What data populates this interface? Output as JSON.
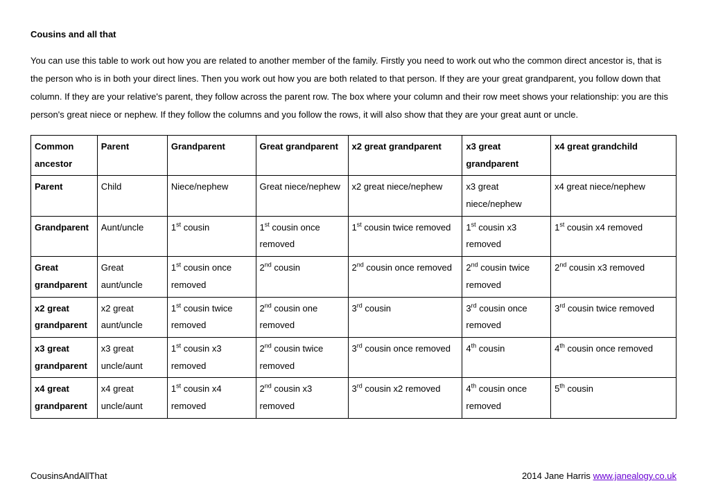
{
  "title": "Cousins and all that",
  "intro": "You can use this table to work out how you are related to another member of the family. Firstly you need to work out who the common direct ancestor is, that is the person who is in both your direct lines. Then you work out how you are both related to that person. If they are your great grandparent, you follow down that column. If they are your relative's parent, they follow across the parent row. The box where your column and their row meet shows your relationship: you are this person's great niece or nephew. If they follow the columns and you follow the rows, it will also show that they are your great aunt or uncle.",
  "headers": {
    "c0": "Common ancestor",
    "c1": "Parent",
    "c2": "Grandparent",
    "c3": "Great grandparent",
    "c4": "x2 great grandparent",
    "c5": "x3 great grandparent",
    "c6": "x4 great grandchild"
  },
  "rows": [
    {
      "h": "Parent",
      "c1": {
        "t": "Child"
      },
      "c2": {
        "t": "Niece/nephew"
      },
      "c3": {
        "t": "Great niece/nephew"
      },
      "c4": {
        "t": "x2 great niece/nephew"
      },
      "c5": {
        "t": "x3 great niece/nephew"
      },
      "c6": {
        "t": "x4 great niece/nephew"
      }
    },
    {
      "h": "Grandparent",
      "c1": {
        "t": "Aunt/uncle"
      },
      "c2": {
        "o": "1",
        "s": "st",
        "r": " cousin"
      },
      "c3": {
        "o": "1",
        "s": "st",
        "r": " cousin once removed"
      },
      "c4": {
        "o": "1",
        "s": "st",
        "r": " cousin twice removed"
      },
      "c5": {
        "o": "1",
        "s": "st",
        "r": " cousin x3 removed"
      },
      "c6": {
        "o": "1",
        "s": "st",
        "r": " cousin x4 removed"
      }
    },
    {
      "h": "Great grandparent",
      "c1": {
        "t": "Great aunt/uncle"
      },
      "c2": {
        "o": "1",
        "s": "st",
        "r": " cousin once removed"
      },
      "c3": {
        "o": "2",
        "s": "nd",
        "r": " cousin"
      },
      "c4": {
        "o": "2",
        "s": "nd",
        "r": " cousin once removed"
      },
      "c5": {
        "o": "2",
        "s": "nd",
        "r": " cousin twice removed"
      },
      "c6": {
        "o": "2",
        "s": "nd",
        "r": " cousin x3 removed"
      }
    },
    {
      "h": "x2 great grandparent",
      "c1": {
        "t": "x2 great aunt/uncle"
      },
      "c2": {
        "o": "1",
        "s": "st",
        "r": " cousin twice removed"
      },
      "c3": {
        "o": "2",
        "s": "nd",
        "r": " cousin one removed"
      },
      "c4": {
        "o": "3",
        "s": "rd",
        "r": " cousin"
      },
      "c5": {
        "o": "3",
        "s": "rd",
        "r": " cousin once removed"
      },
      "c6": {
        "o": "3",
        "s": "rd",
        "r": " cousin twice removed"
      }
    },
    {
      "h": "x3 great grandparent",
      "c1": {
        "t": "x3 great uncle/aunt"
      },
      "c2": {
        "o": "1",
        "s": "st",
        "r": " cousin x3 removed"
      },
      "c3": {
        "o": "2",
        "s": "nd",
        "r": " cousin twice removed"
      },
      "c4": {
        "o": "3",
        "s": "rd",
        "r": " cousin once removed"
      },
      "c5": {
        "o": "4",
        "s": "th",
        "r": " cousin"
      },
      "c6": {
        "o": "4",
        "s": "th",
        "r": " cousin once removed"
      }
    },
    {
      "h": "x4 great grandparent",
      "c1": {
        "t": "x4 great uncle/aunt"
      },
      "c2": {
        "o": "1",
        "s": "st",
        "r": " cousin x4 removed"
      },
      "c3": {
        "o": "2",
        "s": "nd",
        "r": " cousin x3 removed"
      },
      "c4": {
        "o": "3",
        "s": "rd",
        "r": " cousin x2 removed"
      },
      "c5": {
        "o": "4",
        "s": "th",
        "r": " cousin once removed"
      },
      "c6": {
        "o": "5",
        "s": "th",
        "r": " cousin"
      }
    }
  ],
  "footer": {
    "left": "CousinsAndAllThat",
    "right_prefix": "2014  Jane Harris  ",
    "link": "www.janealogy.co.uk"
  }
}
